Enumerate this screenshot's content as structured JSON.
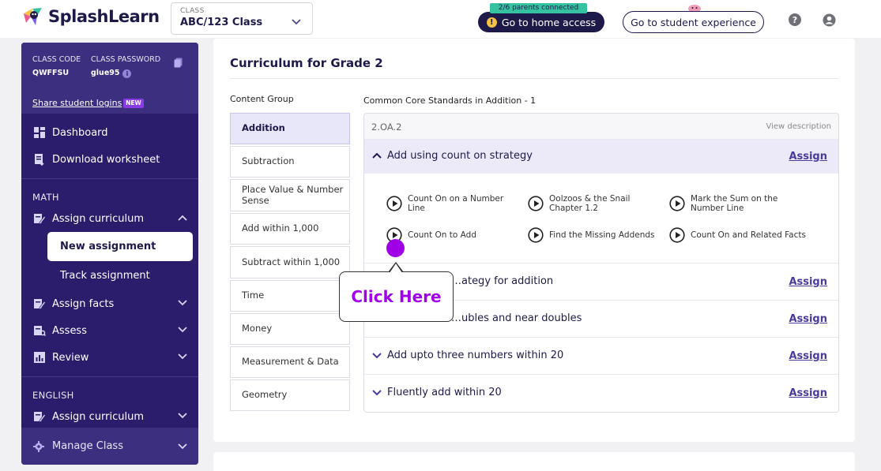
{
  "header": {
    "logo_text": "SplashLearn",
    "class_label": "CLASS",
    "class_value": "ABC/123 Class",
    "parents_badge": "2/6 parents connected",
    "home_access_label": "Go to home access",
    "student_experience_label": "Go to student experience"
  },
  "sidebar": {
    "class_code_label": "CLASS CODE",
    "class_code_value": "QWFFSU",
    "class_password_label": "CLASS PASSWORD",
    "class_password_value": "glue95",
    "share_logins_label": "Share student logins",
    "new_tag": "NEW",
    "dashboard": "Dashboard",
    "download_worksheet": "Download worksheet",
    "math_section": "MATH",
    "assign_curriculum": "Assign curriculum",
    "new_assignment": "New assignment",
    "track_assignment": "Track assignment",
    "assign_facts": "Assign facts",
    "assess": "Assess",
    "review": "Review",
    "english_section": "ENGLISH",
    "english_assign_curriculum": "Assign curriculum",
    "manage_class": "Manage Class"
  },
  "main": {
    "title": "Curriculum for Grade 2",
    "content_group_title": "Content Group",
    "standards_title": "Common Core Standards in Addition - 1",
    "content_groups": [
      {
        "label": "Addition"
      },
      {
        "label": "Subtraction"
      },
      {
        "label": "Place Value & Number Sense"
      },
      {
        "label": "Add within 1,000"
      },
      {
        "label": "Subtract within 1,000"
      },
      {
        "label": "Time"
      },
      {
        "label": "Money"
      },
      {
        "label": "Measurement & Data"
      },
      {
        "label": "Geometry"
      }
    ],
    "standard_code": "2.OA.2",
    "view_description": "View description",
    "open_strategy": "Add using count on strategy",
    "assign_label": "Assign",
    "games": [
      {
        "label": "Count On on a Number Line"
      },
      {
        "label": "Oolzoos & the Snail Chapter 1.2"
      },
      {
        "label": "Mark the Sum on the Number Line"
      },
      {
        "label": "Count On to Add"
      },
      {
        "label": "Find the Missing Addends"
      },
      {
        "label": "Count On and Related Facts"
      }
    ],
    "strategies": [
      {
        "label": "…ategy for addition"
      },
      {
        "label": "…ubles and near doubles"
      },
      {
        "label": "Add upto three numbers within 20"
      },
      {
        "label": "Fluently add within 20"
      }
    ]
  },
  "tooltip": {
    "text": "Click Here"
  },
  "colors": {
    "brand_dark": "#1d1a4a",
    "sidebar_bg": "#2b1d6b",
    "accent_purple": "#a000e6",
    "badge_green": "#35c2a1"
  }
}
